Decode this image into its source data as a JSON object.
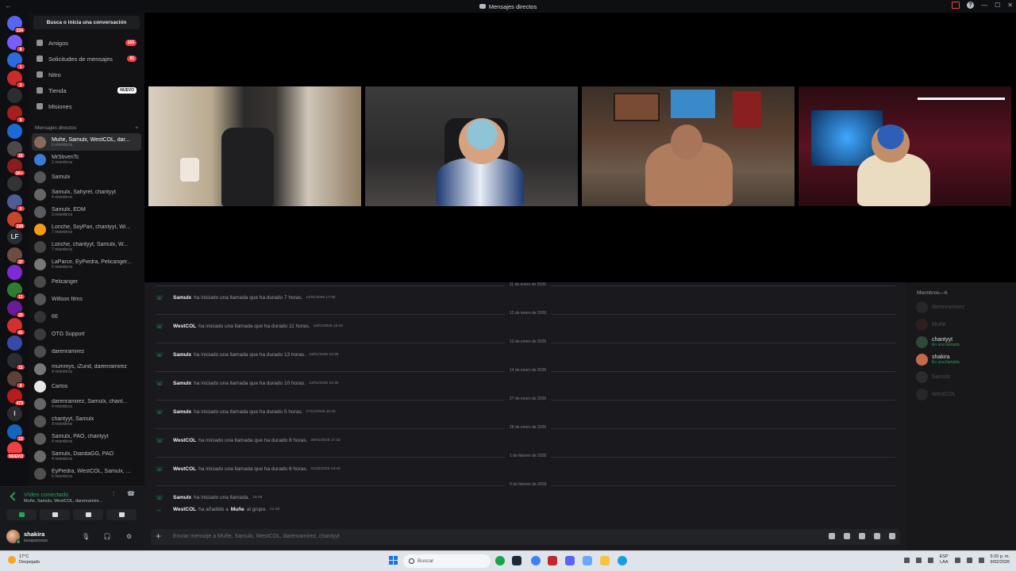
{
  "window": {
    "title": "Mensajes directos"
  },
  "servers": [
    {
      "badge": "234"
    },
    {
      "badge": "8"
    },
    {
      "badge": "1"
    },
    {
      "badge": "3"
    },
    {
      "badge": ""
    },
    {
      "badge": "9"
    },
    {
      "badge": ""
    },
    {
      "badge": "16"
    },
    {
      "badge": "1K+"
    },
    {
      "badge": ""
    },
    {
      "badge": "9"
    },
    {
      "badge": "198"
    },
    {
      "label": "LF"
    },
    {
      "badge": "37"
    },
    {
      "badge": ""
    },
    {
      "badge": "11"
    },
    {
      "badge": "26"
    },
    {
      "badge": "81"
    },
    {
      "badge": ""
    },
    {
      "badge": "11"
    },
    {
      "badge": "9"
    },
    {
      "badge": "473"
    },
    {
      "label": "I"
    },
    {
      "badge": "18"
    },
    {
      "badge": "NUEVO"
    }
  ],
  "sidebar": {
    "search_label": "Busca o inicia una conversación",
    "nav": [
      {
        "label": "Amigos",
        "count": "165"
      },
      {
        "label": "Solicitudes de mensajes",
        "count": "81"
      },
      {
        "label": "Nitro"
      },
      {
        "label": "Tienda",
        "tag": "NUEVO"
      },
      {
        "label": "Misiones"
      }
    ],
    "dm_header": "Mensajes directos",
    "dm_add": "+",
    "dms": [
      {
        "name": "Muñe, Samulx, WestCOL, dar...",
        "sub": "6 miembros",
        "selected": true
      },
      {
        "name": "MrStivenTc",
        "sub": "2 miembros"
      },
      {
        "name": "Samulx",
        "sub": ""
      },
      {
        "name": "Samulx, Sahyrel, chantyyt",
        "sub": "4 miembros"
      },
      {
        "name": "Samulx, EDM",
        "sub": "3 miembros"
      },
      {
        "name": "Lonche, SoyPan, chantyyt, Wi...",
        "sub": "7 miembros"
      },
      {
        "name": "Lonche, chantyyt, Samulx, W...",
        "sub": "7 miembros"
      },
      {
        "name": "LaParce, EyPiedra, Pelicanger...",
        "sub": "6 miembros"
      },
      {
        "name": "Pelicanger",
        "sub": ""
      },
      {
        "name": "Willson films",
        "sub": ""
      },
      {
        "name": "66",
        "sub": ""
      },
      {
        "name": "OTG Support",
        "sub": ""
      },
      {
        "name": "darenramirez",
        "sub": ""
      },
      {
        "name": "mummys, iZund, darenramirez",
        "sub": "4 miembros"
      },
      {
        "name": "Carlos",
        "sub": ""
      },
      {
        "name": "darenramirez, Samulx, chant...",
        "sub": "4 miembros"
      },
      {
        "name": "chantyyt, Samulx",
        "sub": "3 miembros"
      },
      {
        "name": "Samulx, PAO, chantyyt",
        "sub": "4 miembros"
      },
      {
        "name": "Samulx, DianitaGG, PAO",
        "sub": "4 miembros"
      },
      {
        "name": "EyPiedra, WestCOL, Samulx, ...",
        "sub": "6 miembros"
      }
    ]
  },
  "voice": {
    "status": "Vídeo conectado",
    "channel": "Muñe, Samulx, WestCOL, darenramire..."
  },
  "user": {
    "name": "shakira",
    "tag": "lasapasssss"
  },
  "chat": {
    "entries": [
      {
        "date": "11 de enero de 2026",
        "who": "Samulx",
        "text": "ha iniciado una llamada que ha durado 7 horas.",
        "ts": "11/01/2026 17:05"
      },
      {
        "date": "12 de enero de 2026",
        "who": "WestCOL",
        "text": "ha iniciado una llamada que ha durado 11 horas.",
        "ts": "12/01/2026 16:34"
      },
      {
        "date": "13 de enero de 2026",
        "who": "Samulx",
        "text": "ha iniciado una llamada que ha durado 13 horas.",
        "ts": "13/01/2026 16:36"
      },
      {
        "date": "14 de enero de 2026",
        "who": "Samulx",
        "text": "ha iniciado una llamada que ha durado 10 horas.",
        "ts": "14/01/2026 15:35"
      },
      {
        "date": "27 de enero de 2026",
        "who": "Samulx",
        "text": "ha iniciado una llamada que ha durado 5 horas.",
        "ts": "27/01/2026 20:34"
      },
      {
        "date": "28 de enero de 2026",
        "who": "WestCOL",
        "text": "ha iniciado una llamada que ha durado 8 horas.",
        "ts": "28/01/2026 17:32"
      },
      {
        "date": "1 de febrero de 2026",
        "who": "WestCOL",
        "text": "ha iniciado una llamada que ha durado 6 horas.",
        "ts": "01/02/2026 13:44"
      }
    ],
    "last_date": "9 de febrero de 2026",
    "last1": {
      "who": "Samulx",
      "text": "ha iniciado una llamada.",
      "ts": "19:48"
    },
    "last2": {
      "who": "WestCOL",
      "text": "ha añadido a",
      "target": "Muñe",
      "tail": "al grupo.",
      "ts": "21:19"
    }
  },
  "composer": {
    "placeholder": "Enviar mensaje a Muñe, Samulx, WestCOL, darenramirez, chantyyt"
  },
  "members": {
    "header": "Miembros—6",
    "list": [
      {
        "name": "darenramirez",
        "sub": "",
        "dim": true
      },
      {
        "name": "Muñe",
        "sub": "",
        "dim": true
      },
      {
        "name": "chantyyt",
        "sub": "En una llamada",
        "dim": false
      },
      {
        "name": "shakira",
        "sub": "En una llamada",
        "dim": false
      },
      {
        "name": "Samulx",
        "sub": "",
        "dim": true
      },
      {
        "name": "WestCOL",
        "sub": "",
        "dim": true
      }
    ]
  },
  "taskbar": {
    "weather_temp": "17°C",
    "weather_desc": "Despejado",
    "search": "Buscar",
    "lang1": "ESP",
    "lang2": "LAA",
    "time": "9:20 p. m.",
    "date": "9/02/2026"
  }
}
